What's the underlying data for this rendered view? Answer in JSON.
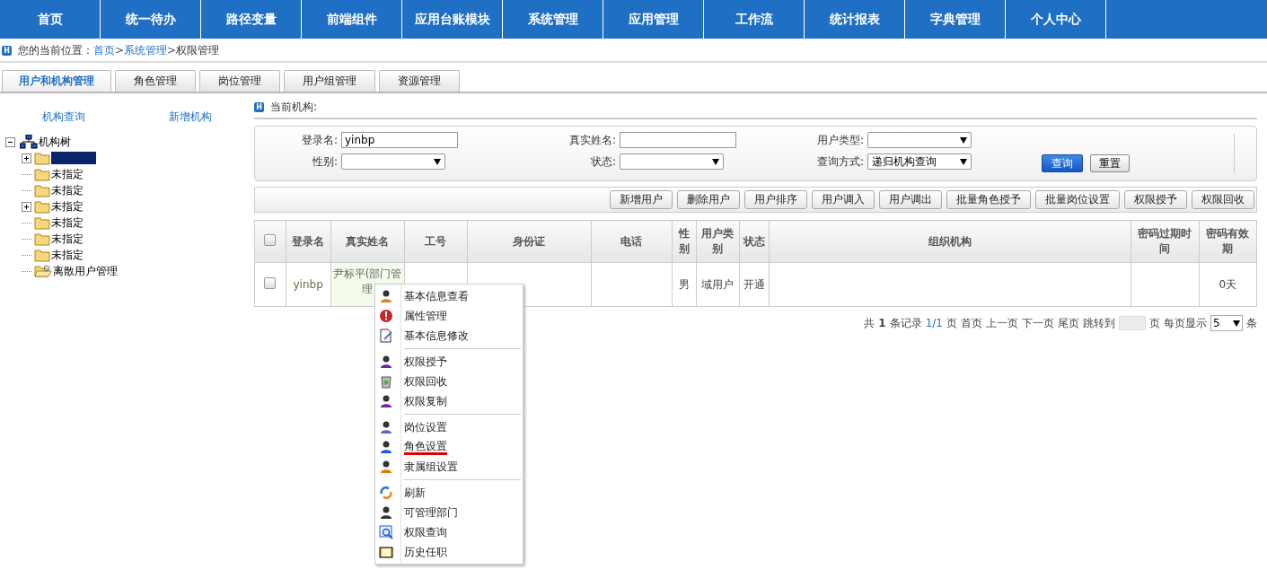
{
  "nav": [
    {
      "label": "首页",
      "selected": false
    },
    {
      "label": "统一待办",
      "selected": false
    },
    {
      "label": "路径变量",
      "selected": false
    },
    {
      "label": "前端组件",
      "selected": false
    },
    {
      "label": "应用台账模块",
      "selected": false
    },
    {
      "label": "系统管理",
      "selected": false
    },
    {
      "label": "应用管理",
      "selected": false
    },
    {
      "label": "工作流",
      "selected": false
    },
    {
      "label": "统计报表",
      "selected": false
    },
    {
      "label": "字典管理",
      "selected": false
    },
    {
      "label": "个人中心",
      "selected": false
    }
  ],
  "breadcrumb": {
    "badge": "H",
    "label": "您的当前位置：",
    "links": [
      "首页",
      "系统管理"
    ],
    "current": "权限管理",
    "separator": ">"
  },
  "tabs": [
    {
      "label": "用户和机构管理",
      "selected": true
    },
    {
      "label": "角色管理",
      "selected": false
    },
    {
      "label": "岗位管理",
      "selected": false
    },
    {
      "label": "用户组管理",
      "selected": false
    },
    {
      "label": "资源管理",
      "selected": false
    }
  ],
  "sidebar": {
    "links": [
      "机构查询",
      "新增机构"
    ],
    "tree": {
      "label": "机构树",
      "expanded": true,
      "children": [
        {
          "selected": true,
          "expandable": true
        },
        {
          "label": "未指定",
          "selected": false,
          "expandable": false
        },
        {
          "label": "未指定",
          "selected": false,
          "expandable": false
        },
        {
          "label": "未指定",
          "selected": false,
          "expandable": true
        },
        {
          "label": "未指定",
          "selected": false,
          "expandable": false
        },
        {
          "label": "未指定",
          "selected": false,
          "expandable": false
        },
        {
          "label": "未指定",
          "selected": false,
          "expandable": false
        },
        {
          "label": "离散用户管理",
          "selected": false,
          "expandable": false,
          "kind": "open"
        }
      ]
    }
  },
  "current_org": {
    "badge": "H",
    "label": "当前机构:"
  },
  "search": {
    "fields": [
      {
        "label": "登录名:",
        "kind": "text",
        "value": "yinbp"
      },
      {
        "label": "真实姓名:",
        "kind": "text"
      },
      {
        "label": "用户类型:",
        "kind": "select"
      },
      {
        "label": "性别:",
        "kind": "select"
      },
      {
        "label": "状态:",
        "kind": "select"
      },
      {
        "label": "查询方式:",
        "kind": "select",
        "value": "递归机构查询"
      }
    ],
    "buttons": [
      {
        "label": "查询",
        "kind": "primary"
      },
      {
        "label": "重置",
        "kind": "plain"
      }
    ]
  },
  "toolbar": [
    "新增用户",
    "删除用户",
    "用户排序",
    "用户调入",
    "用户调出",
    "批量角色授予",
    "批量岗位设置",
    "权限授予",
    "权限回收"
  ],
  "table": {
    "all_checked": false,
    "columns": [
      "登录名",
      "真实姓名",
      "工号",
      "身份证",
      "电话",
      "性别",
      "用户类别",
      "状态",
      "组织机构",
      "密码过期时间",
      "密码有效期"
    ],
    "rows": [
      {
        "checked": false,
        "cells": [
          "yinbp",
          "尹标平(部门管理",
          "",
          "",
          "",
          "男",
          "域用户",
          "开通",
          "",
          "",
          "0天"
        ]
      }
    ]
  },
  "pagination": {
    "prefix": "共",
    "count": "1",
    "records": "条记录",
    "page": "1/1",
    "page_suffix": "页",
    "links": [
      "首页",
      "上一页",
      "下一页",
      "尾页"
    ],
    "jump": "跳转到",
    "jump_suffix": "页",
    "per_page": "每页显示",
    "size": "5",
    "size_suffix": "条"
  },
  "context_menu": [
    [
      {
        "label": "基本信息查看",
        "kind": "person",
        "marked": false
      },
      {
        "label": "属性管理",
        "kind": "alert",
        "marked": false
      },
      {
        "label": "基本信息修改",
        "kind": "edit",
        "marked": false
      }
    ],
    [
      {
        "label": "权限授予",
        "kind": "grant",
        "marked": false
      },
      {
        "label": "权限回收",
        "kind": "bin",
        "marked": false
      },
      {
        "label": "权限复制",
        "kind": "copy",
        "marked": false
      }
    ],
    [
      {
        "label": "岗位设置",
        "kind": "post",
        "marked": false
      },
      {
        "label": "角色设置",
        "kind": "role",
        "marked": true
      },
      {
        "label": "隶属组设置",
        "kind": "group",
        "marked": false
      }
    ],
    [
      {
        "label": "刷新",
        "kind": "refresh",
        "marked": false
      },
      {
        "label": "可管理部门",
        "kind": "user",
        "marked": false
      },
      {
        "label": "权限查询",
        "kind": "query",
        "marked": false
      },
      {
        "label": "历史任职",
        "kind": "book",
        "marked": false
      }
    ]
  ]
}
